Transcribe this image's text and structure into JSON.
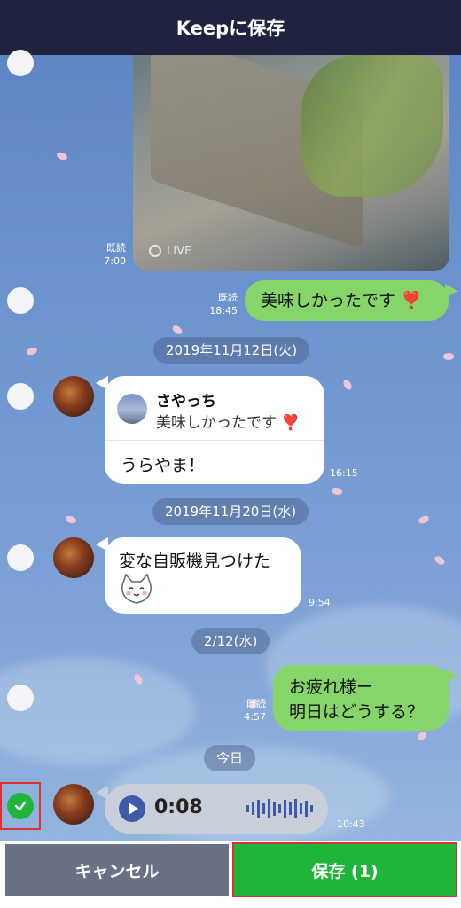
{
  "header": {
    "title": "Keepに保存"
  },
  "messages": {
    "photo": {
      "read_label": "既読",
      "time": "7:00",
      "live_label": "LIVE"
    },
    "m1": {
      "text": "美味しかったです",
      "emoji": "❣️",
      "read_label": "既読",
      "time": "18:45"
    },
    "date1": "2019年11月12日(火)",
    "m2": {
      "quote_name": "さやっち",
      "quote_text": "美味しかったです",
      "quote_emoji": "❣️",
      "text": "うらやま！",
      "time": "16:15"
    },
    "date2": "2019年11月20日(水)",
    "m3": {
      "text": "変な自販機見つけた",
      "time": "9:54"
    },
    "date3": "2/12(水)",
    "m4": {
      "line1": "お疲れ様ー",
      "line2": "明日はどうする？",
      "read_label": "既読",
      "time": "4:57"
    },
    "date4": "今日",
    "m5": {
      "duration": "0:08",
      "time": "10:43",
      "selected": true
    }
  },
  "footer": {
    "cancel_label": "キャンセル",
    "save_label": "保存 (1)"
  },
  "colors": {
    "header": "#1f2340",
    "green_bubble": "#86d56a",
    "save_button": "#1fb53a",
    "cancel_button": "#6a7184",
    "highlight": "#e03030"
  }
}
